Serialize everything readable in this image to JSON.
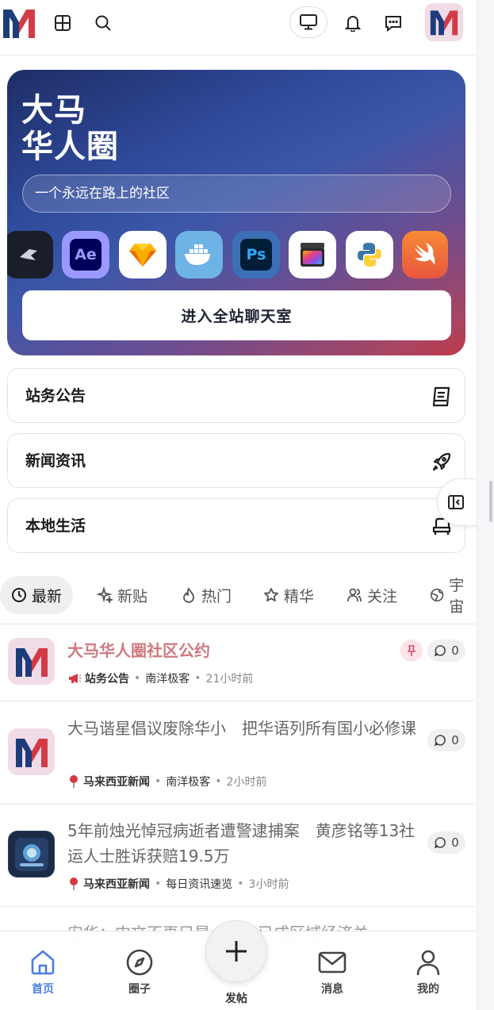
{
  "topbar": {
    "logo_icon": "m-logo-icon",
    "icons": [
      "grid-icon",
      "search-icon",
      "monitor-icon",
      "bell-icon",
      "message-square-icon"
    ]
  },
  "hero": {
    "title_line1": "大马",
    "title_line2": "华人圈",
    "search_placeholder": "一个永远在路上的社区",
    "apps": [
      "blender-icon",
      "after-effects-icon",
      "sketch-icon",
      "docker-icon",
      "photoshop-icon",
      "final-cut-icon",
      "python-icon",
      "swift-icon"
    ],
    "app_ae_label": "Ae",
    "app_ps_label": "Ps",
    "chat_button": "进入全站聊天室"
  },
  "categories": [
    {
      "label": "站务公告",
      "icon": "notebook-icon"
    },
    {
      "label": "新闻资讯",
      "icon": "rocket-icon"
    },
    {
      "label": "本地生活",
      "icon": "armchair-icon"
    }
  ],
  "tabs": [
    {
      "label": "最新",
      "icon": "clock-icon",
      "active": true
    },
    {
      "label": "新贴",
      "icon": "sparkle-icon"
    },
    {
      "label": "热门",
      "icon": "flame-icon"
    },
    {
      "label": "精华",
      "icon": "star-icon"
    },
    {
      "label": "关注",
      "icon": "users-icon"
    },
    {
      "label": "宇宙",
      "icon": "globe-icon"
    }
  ],
  "posts": [
    {
      "title": "大马华人圈社区公约",
      "category_icon": "megaphone-icon",
      "category": "站务公告",
      "author": "南洋极客",
      "time": "21小时前",
      "comments": "0",
      "pinned": true
    },
    {
      "title": "大马谐星倡议废除华小　把华语列所有国小必修课",
      "category_icon": "pin-icon",
      "category": "马来西亚新闻",
      "author": "南洋极客",
      "time": "2小时前",
      "comments": "0"
    },
    {
      "title": "5年前烛光悼冠病逝者遭警逮捕案　黄彦铭等13社运人士胜诉获赔19.5万",
      "category_icon": "pin-icon",
      "category": "马来西亚新闻",
      "author": "每日资讯速览",
      "time": "3小时前",
      "comments": "0"
    },
    {
      "title": "安华：中文不再只是…语…已成区域经济关"
    }
  ],
  "bottom_nav": [
    {
      "label": "首页",
      "icon": "home-icon",
      "active": true
    },
    {
      "label": "圈子",
      "icon": "compass-icon"
    },
    {
      "label": "发帖",
      "icon": "plus-icon"
    },
    {
      "label": "消息",
      "icon": "mail-icon"
    },
    {
      "label": "我的",
      "icon": "user-icon"
    }
  ],
  "colors": {
    "accent": "#4a7fe0",
    "pinned_title": "#d0797f",
    "brand_red": "#d33a45",
    "brand_navy": "#1d3d7a"
  }
}
